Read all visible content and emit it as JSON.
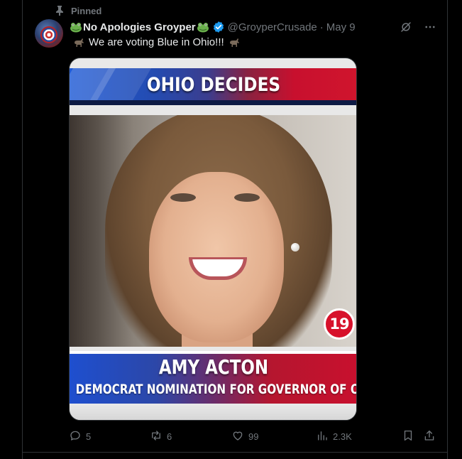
{
  "pinned": {
    "label": "Pinned"
  },
  "author": {
    "display_name": "No Apologies Groyper",
    "handle": "@GroyperCrusade",
    "date": "May 9"
  },
  "tweet": {
    "text": "We are voting Blue in Ohio!!!"
  },
  "media": {
    "banner_title": "OHIO DECIDES",
    "badge_number": "19",
    "name": "AMY ACTON",
    "subtitle": "DEMOCRAT NOMINATION FOR GOVERNOR OF OHIO"
  },
  "metrics": {
    "replies": "5",
    "reposts": "6",
    "likes": "99",
    "views": "2.3K"
  },
  "icons": [
    "pin-icon",
    "verified-icon",
    "grok-icon",
    "more-icon",
    "reply-icon",
    "repost-icon",
    "like-icon",
    "views-icon",
    "bookmark-icon",
    "share-icon",
    "frog-emoji",
    "donkey-emoji"
  ],
  "colors": {
    "background": "#000000",
    "text": "#e7e9ea",
    "muted": "#71767b",
    "verified": "#1d9bf0",
    "border": "#2f3336"
  }
}
